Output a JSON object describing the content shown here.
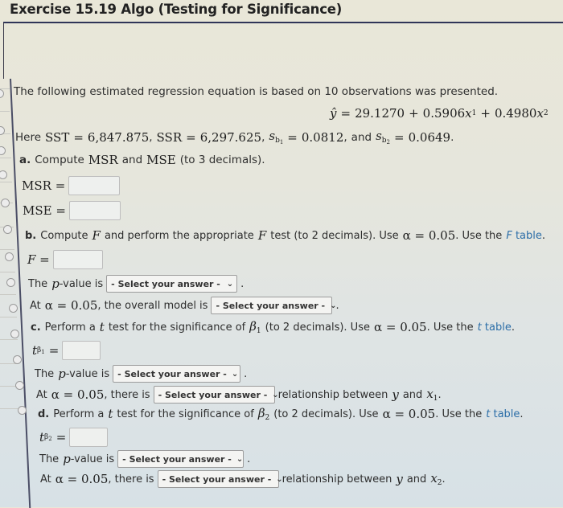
{
  "header": {
    "title": "Exercise 15.19 Algo (Testing for Significance)"
  },
  "intro": {
    "text": "The following estimated regression equation is based on 10 observations was presented.",
    "equation": {
      "lhs": "ŷ",
      "rhs_const": "29.1270",
      "coef1": "0.5906",
      "var1": "x",
      "var1_sub": "1",
      "coef2": "0.4980",
      "var2": "x",
      "var2_sub": "2"
    },
    "given_prefix": "Here",
    "sst_label": "SST",
    "sst_value": "6,847.875",
    "ssr_label": "SSR",
    "ssr_value": "6,297.625",
    "sb1_label": "s",
    "sb1_sub": "b1",
    "sb1_value": "0.0812",
    "and": "and",
    "sb2_label": "s",
    "sb2_sub": "b2",
    "sb2_value": "0.0649"
  },
  "part_a": {
    "letter": "a.",
    "text_pre": "Compute",
    "msr": "MSR",
    "and": "and",
    "mse": "MSE",
    "text_post": "(to 3 decimals).",
    "msr_label": "MSR =",
    "mse_label": "MSE =",
    "msr_value": "",
    "mse_value": ""
  },
  "part_b": {
    "letter": "b.",
    "text1": "Compute",
    "F": "F",
    "text2": "and perform the appropriate",
    "text3": "test (to 2 decimals). Use",
    "alpha": "α = 0.05",
    "text4": ". Use the",
    "link_italic": "F",
    "link_text": "table",
    "f_label": "F =",
    "f_value": "",
    "pvalue_pre": "The",
    "pvalue_p": "p",
    "pvalue_post": "-value is",
    "pvalue_select": "- Select your answer -",
    "model_pre": "At",
    "model_alpha": "α = 0.05",
    "model_text": ", the overall model is",
    "model_select": "- Select your answer -"
  },
  "part_c": {
    "letter": "c.",
    "text1": "Perform a",
    "t": "t",
    "text2": "test for the significance of",
    "beta": "β",
    "beta_sub": "1",
    "text3": "(to 2 decimals). Use",
    "alpha": "α = 0.05",
    "text4": ". Use the",
    "link_italic": "t",
    "link_text": "table",
    "t_label": "t",
    "t_sub": "β1",
    "t_value": "",
    "pvalue_pre": "The",
    "pvalue_p": "p",
    "pvalue_post": "-value is",
    "pvalue_select": "- Select your answer -",
    "rel_pre": "At",
    "rel_alpha": "α = 0.05",
    "rel_text": ", there is",
    "rel_select": "- Select your answer -",
    "rel_post": "relationship between",
    "y": "y",
    "and": "and",
    "x": "x",
    "x_sub": "1"
  },
  "part_d": {
    "letter": "d.",
    "text1": "Perform a",
    "t": "t",
    "text2": "test for the significance of",
    "beta": "β",
    "beta_sub": "2",
    "text3": "(to 2 decimals). Use",
    "alpha": "α = 0.05",
    "text4": ". Use the",
    "link_italic": "t",
    "link_text": "table",
    "t_label": "t",
    "t_sub": "β2",
    "t_value": "",
    "pvalue_pre": "The",
    "pvalue_p": "p",
    "pvalue_post": "-value is",
    "pvalue_select": "- Select your answer -",
    "rel_pre": "At",
    "rel_alpha": "α = 0.05",
    "rel_text": ", there is",
    "rel_select": "- Select your answer -",
    "rel_post": "relationship between",
    "y": "y",
    "and": "and",
    "x": "x",
    "x_sub": "2"
  },
  "colors": {
    "link": "#2c6ea8",
    "rule": "#2f3558"
  }
}
